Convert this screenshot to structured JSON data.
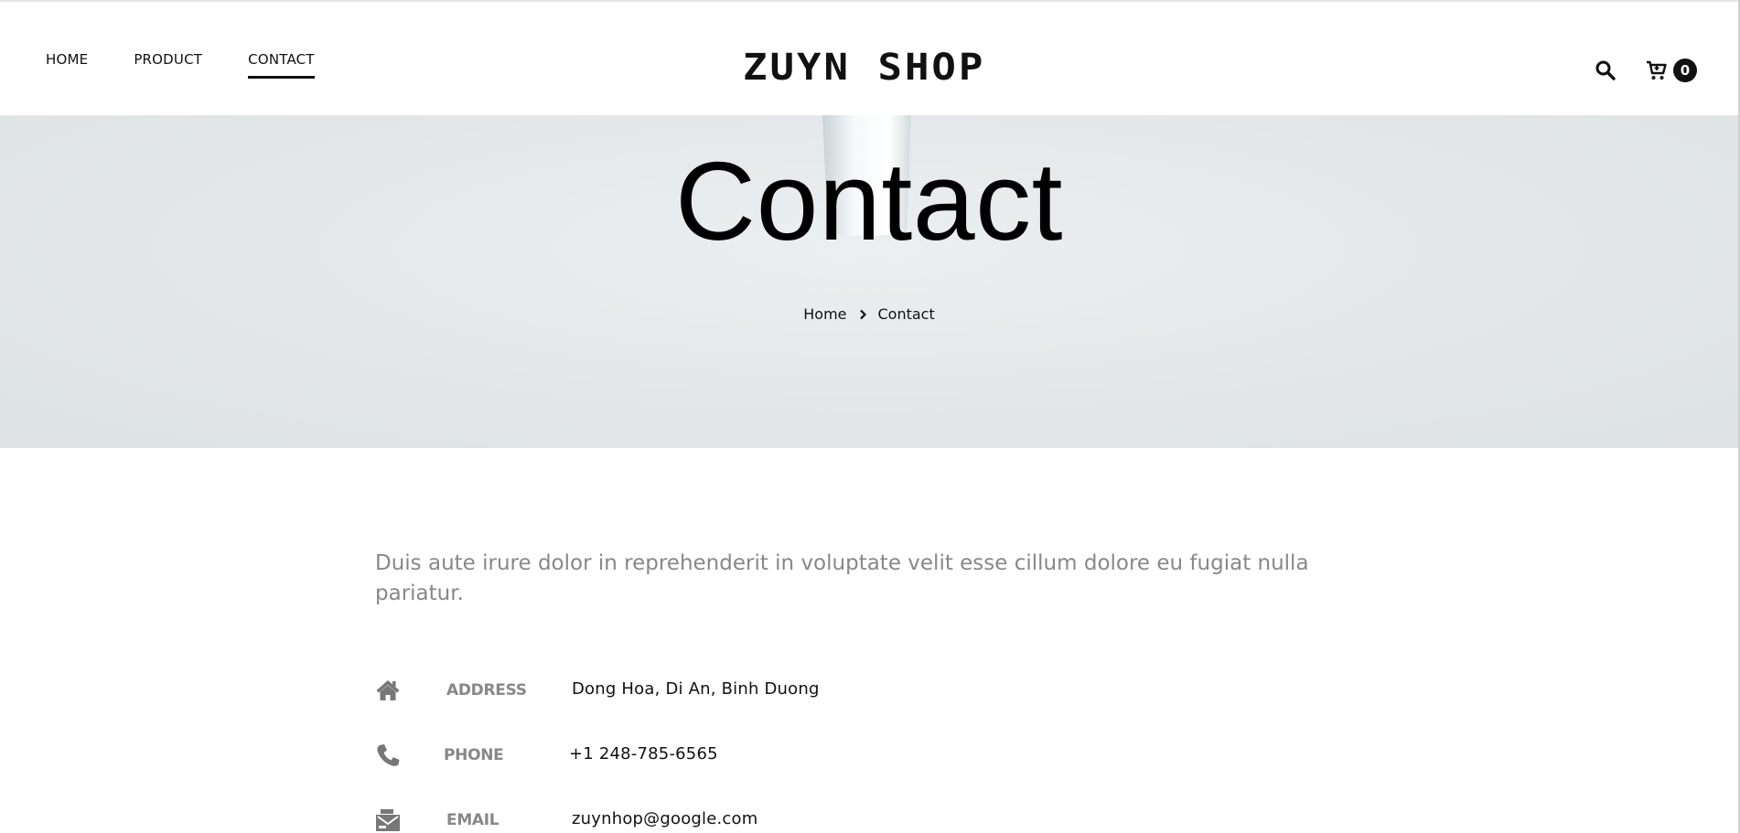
{
  "header": {
    "nav": [
      {
        "label": "HOME"
      },
      {
        "label": "PRODUCT"
      },
      {
        "label": "CONTACT",
        "active": true
      }
    ],
    "logo_text": "ZUYN SHOP",
    "search_icon": "search-icon",
    "cart_icon": "cart-icon",
    "cart_count": "0"
  },
  "hero": {
    "title": "Contact",
    "breadcrumb": {
      "home": "Home",
      "separator_icon": "chevron-right-icon",
      "current": "Contact"
    }
  },
  "content": {
    "intro": "Duis aute irure dolor in reprehenderit in voluptate velit esse cillum dolore eu fugiat nulla pariatur.",
    "info": [
      {
        "icon": "home-icon",
        "label": "ADDRESS",
        "value": "Dong Hoa, Di An, Binh Duong"
      },
      {
        "icon": "phone-icon",
        "label": "PHONE",
        "value": "+1 248-785-6565"
      },
      {
        "icon": "email-icon",
        "label": "EMAIL",
        "value": "zuynhop@google.com"
      }
    ]
  },
  "colors": {
    "text_primary": "#111111",
    "text_muted": "#888888",
    "hero_background": "#e3e7e9",
    "badge_background": "#111111"
  }
}
